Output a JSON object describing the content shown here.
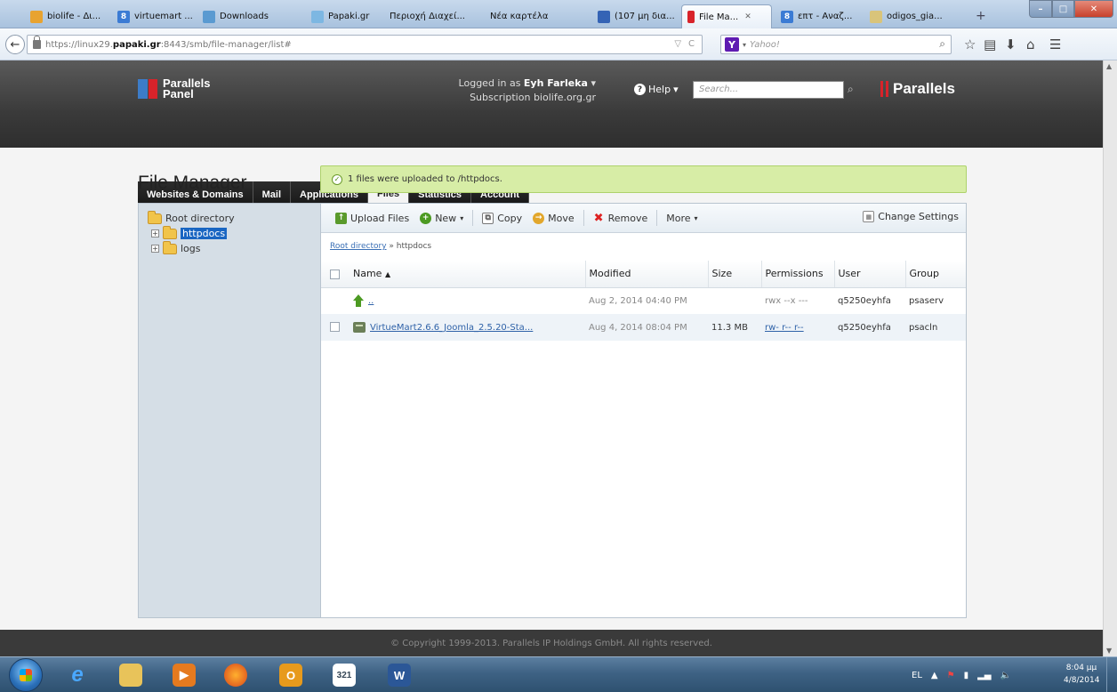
{
  "browser": {
    "tabs": [
      {
        "label": "biolife - Δι...",
        "active": false
      },
      {
        "label": "virtuemart ...",
        "active": false
      },
      {
        "label": "Downloads",
        "active": false
      },
      {
        "label": "Papaki.gr",
        "active": false
      },
      {
        "label": "Περιοχή Διαχεί...",
        "active": false
      },
      {
        "label": "Νέα καρτέλα",
        "active": false
      },
      {
        "label": "(107 μη δια...",
        "active": false
      },
      {
        "label": "File Ma...",
        "active": true
      },
      {
        "label": "επτ - Αναζ...",
        "active": false
      },
      {
        "label": "odigos_gia...",
        "active": false
      }
    ],
    "new_tab": "+",
    "url_prefix": "https://linux29.",
    "url_domain": "papaki.gr",
    "url_suffix": ":8443/smb/file-manager/list#",
    "search_placeholder": "Yahoo!",
    "search_engine_logo": "Y"
  },
  "panel": {
    "logo_line1": "Parallels",
    "logo_line2": "Panel",
    "logged_in_prefix": "Logged in as",
    "user_name": "Eyh Farleka",
    "subscription_prefix": "Subscription",
    "subscription": "biolife.org.gr",
    "help_label": "Help",
    "search_placeholder": "Search...",
    "brand": "Parallels",
    "tabs": [
      {
        "label": "Websites & Domains",
        "active": false
      },
      {
        "label": "Mail",
        "active": false
      },
      {
        "label": "Applications",
        "active": false
      },
      {
        "label": "Files",
        "active": true
      },
      {
        "label": "Statistics",
        "active": false
      },
      {
        "label": "Account",
        "active": false
      }
    ]
  },
  "page": {
    "title": "File Manager",
    "flash_message": "1 files were uploaded to /httpdocs."
  },
  "tree": {
    "root": "Root directory",
    "children": [
      {
        "label": "httpdocs",
        "selected": true
      },
      {
        "label": "logs",
        "selected": false
      }
    ]
  },
  "toolbar": {
    "upload": "Upload Files",
    "new": "New",
    "copy": "Copy",
    "move": "Move",
    "remove": "Remove",
    "more": "More",
    "settings": "Change Settings"
  },
  "breadcrumb": {
    "root": "Root directory",
    "sep": "»",
    "current": "httpdocs"
  },
  "table": {
    "columns": [
      "Name",
      "Modified",
      "Size",
      "Permissions",
      "User",
      "Group"
    ],
    "sort_indicator": "▲",
    "rows": [
      {
        "name": "..",
        "modified": "Aug 2, 2014 04:40 PM",
        "size": "",
        "permissions": "rwx --x ---",
        "user": "q5250eyhfa",
        "group": "psaserv"
      },
      {
        "name": "VirtueMart2.6.6_Joomla_2.5.20-Sta...",
        "modified": "Aug 4, 2014 08:04 PM",
        "size": "11.3 MB",
        "permissions": "rw- r-- r--",
        "user": "q5250eyhfa",
        "group": "psacln"
      }
    ]
  },
  "footer": {
    "copyright": "© Copyright 1999-2013. Parallels IP Holdings GmbH. All rights reserved."
  },
  "taskbar": {
    "language": "EL",
    "time": "8:04 μμ",
    "date": "4/8/2014"
  },
  "colors": {
    "flash_bg": "#d7eda6",
    "tree_selected": "#1a66c2",
    "link": "#2f62a8",
    "brand_red": "#d8232a"
  }
}
